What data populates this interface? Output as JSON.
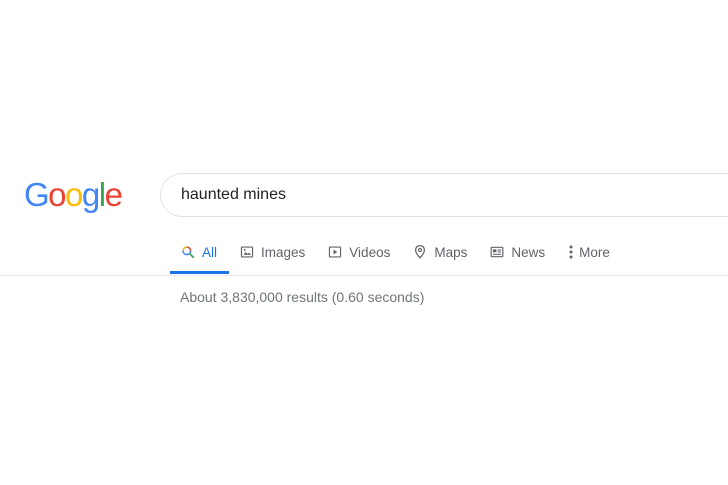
{
  "logo": {
    "letters": [
      "G",
      "o",
      "o",
      "g",
      "l",
      "e"
    ],
    "colors": [
      "#4285f4",
      "#ea4335",
      "#fbbc05",
      "#4285f4",
      "#34a853",
      "#ea4335"
    ]
  },
  "search": {
    "query": "haunted mines"
  },
  "tabs": [
    {
      "label": "All",
      "icon": "search-icon",
      "active": true
    },
    {
      "label": "Images",
      "icon": "image-icon",
      "active": false
    },
    {
      "label": "Videos",
      "icon": "video-icon",
      "active": false
    },
    {
      "label": "Maps",
      "icon": "map-pin-icon",
      "active": false
    },
    {
      "label": "News",
      "icon": "news-icon",
      "active": false
    },
    {
      "label": "More",
      "icon": "more-vert-icon",
      "active": false
    }
  ],
  "results": {
    "stats": "About 3,830,000 results (0.60 seconds)"
  },
  "colors": {
    "accent": "#1a73e8",
    "muted": "#5f6368"
  }
}
